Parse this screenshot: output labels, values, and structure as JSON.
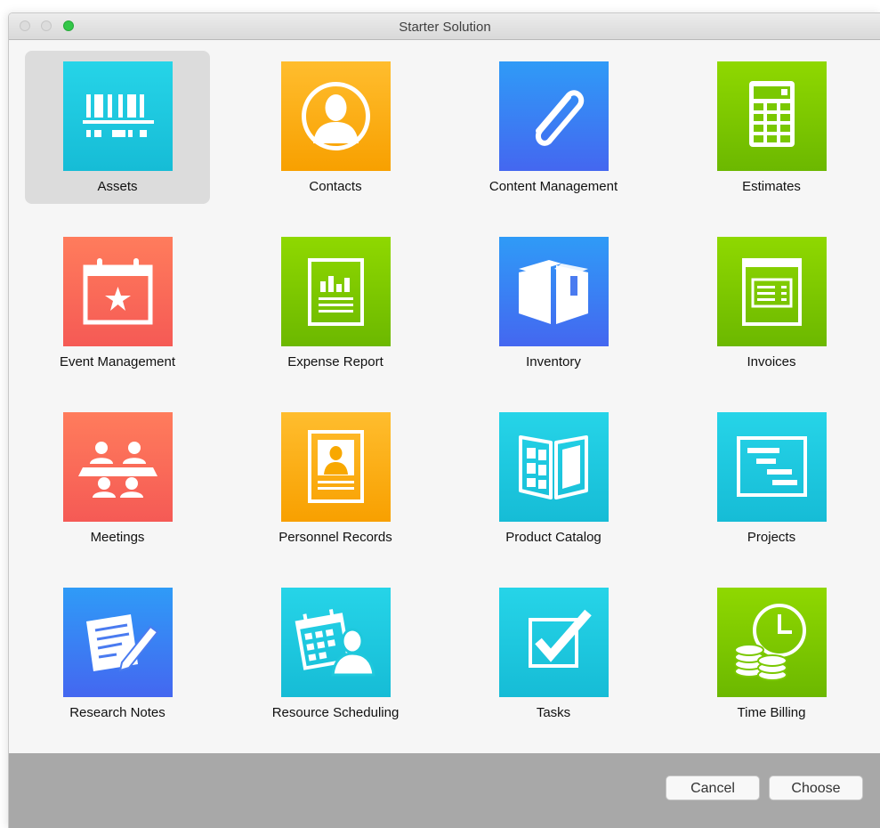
{
  "window": {
    "title": "Starter Solution"
  },
  "templates": [
    {
      "label": "Assets",
      "icon": "barcode-icon",
      "color": "#1ec8dc",
      "selected": true
    },
    {
      "label": "Contacts",
      "icon": "person-icon",
      "color": "#f8a800"
    },
    {
      "label": "Content Management",
      "icon": "paperclip-icon",
      "color": "#3b82f6"
    },
    {
      "label": "Estimates",
      "icon": "calculator-icon",
      "color": "#7ac800"
    },
    {
      "label": "Event Management",
      "icon": "calendar-star-icon",
      "color": "#f86a55"
    },
    {
      "label": "Expense Report",
      "icon": "report-chart-icon",
      "color": "#7ac800"
    },
    {
      "label": "Inventory",
      "icon": "box-icon",
      "color": "#3b82f6"
    },
    {
      "label": "Invoices",
      "icon": "invoice-icon",
      "color": "#7ac800"
    },
    {
      "label": "Meetings",
      "icon": "meeting-people-icon",
      "color": "#f86a55"
    },
    {
      "label": "Personnel Records",
      "icon": "id-badge-icon",
      "color": "#f8a800"
    },
    {
      "label": "Product Catalog",
      "icon": "catalog-book-icon",
      "color": "#1ec8dc"
    },
    {
      "label": "Projects",
      "icon": "gantt-chart-icon",
      "color": "#1ec8dc"
    },
    {
      "label": "Research Notes",
      "icon": "note-pencil-icon",
      "color": "#3b82f6"
    },
    {
      "label": "Resource Scheduling",
      "icon": "calendar-person-icon",
      "color": "#1ec8dc"
    },
    {
      "label": "Tasks",
      "icon": "checkbox-icon",
      "color": "#1ec8dc"
    },
    {
      "label": "Time Billing",
      "icon": "clock-coins-icon",
      "color": "#7ac800"
    }
  ],
  "footer": {
    "cancel_label": "Cancel",
    "choose_label": "Choose"
  }
}
